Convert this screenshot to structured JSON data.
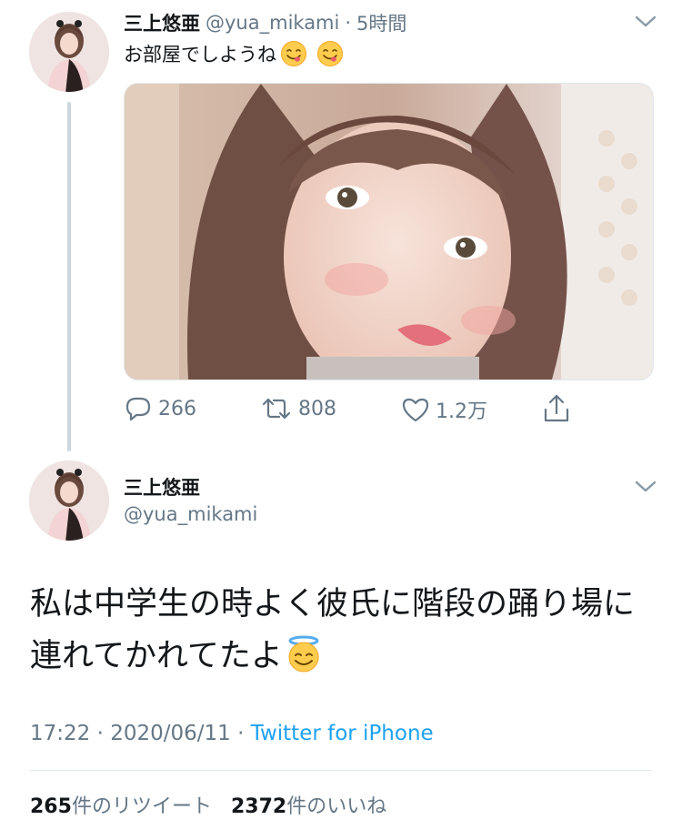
{
  "reply_tweet": {
    "author_name": "三上悠亜",
    "handle": "@yua_mikami",
    "separator": "·",
    "time": "5時間",
    "text": "お部屋でしようね",
    "emojis": [
      "yum-emoji",
      "yum-emoji"
    ],
    "actions": {
      "reply_count": "266",
      "retweet_count": "808",
      "like_count": "1.2万"
    }
  },
  "main_tweet": {
    "author_name": "三上悠亜",
    "handle": "@yua_mikami",
    "text": "私は中学生の時よく彼氏に階段の踊り場に連れてかれてたよ",
    "emoji": "halo-emoji",
    "timestamp": "17:22 · 2020/06/11 · ",
    "source": "Twitter for iPhone",
    "retweets_count": "265",
    "retweets_label": "件のリツイート",
    "likes_count": "2372",
    "likes_label": "件のいいね"
  },
  "colors": {
    "text": "#14171a",
    "secondary": "#657786",
    "link": "#1da1f2",
    "divider": "#e1e8ed"
  }
}
